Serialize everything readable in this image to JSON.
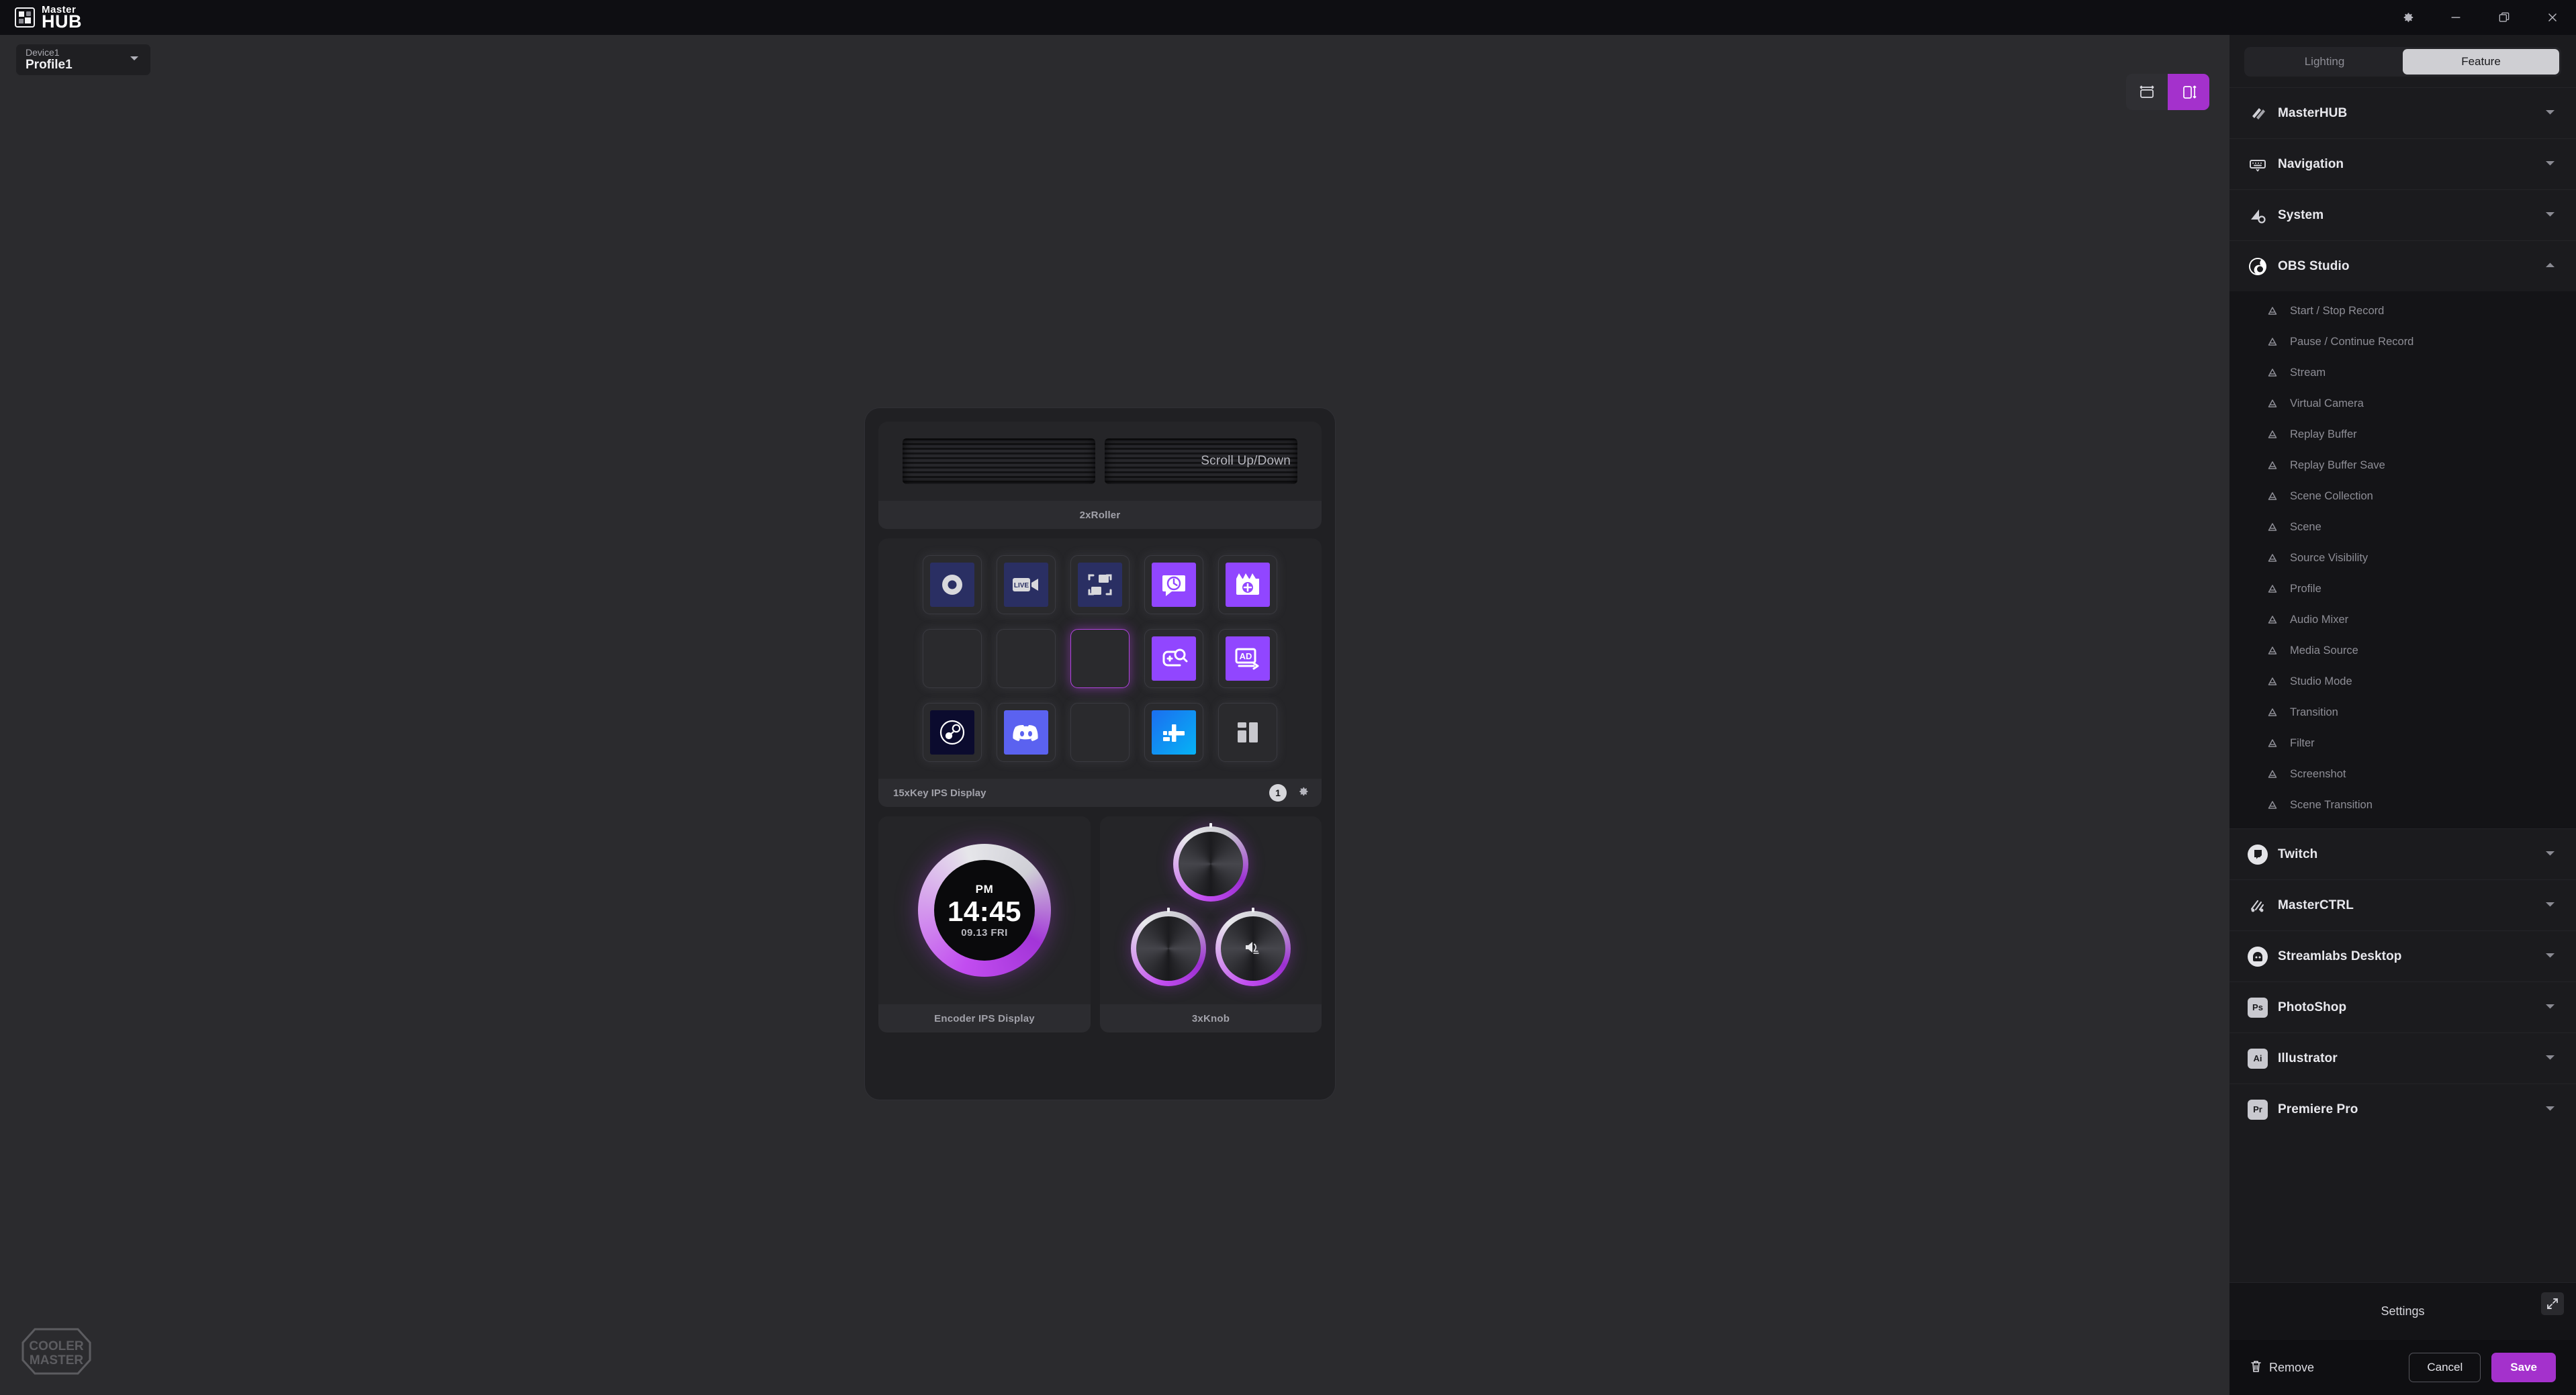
{
  "app": {
    "brand_line1": "Master",
    "brand_line2": "HUB",
    "accent": "#a431cc",
    "selection_accent": "#b044dd"
  },
  "titlebar": {
    "settings_icon": "gear-icon",
    "minimize_icon": "minimize-icon",
    "maximize_icon": "maximize-icon",
    "close_icon": "close-icon"
  },
  "profile": {
    "device_label": "Device1",
    "profile_label": "Profile1",
    "caret_icon": "chevron-down-icon"
  },
  "layout_toggle": {
    "horizontal_label": "horizontal-layout-icon",
    "vertical_label": "vertical-layout-icon",
    "active": "vertical"
  },
  "device": {
    "roller": {
      "panel_label": "2xRoller",
      "scroll_text": "Scroll Up/Down"
    },
    "keys": {
      "panel_label": "15xKey IPS Display",
      "page_number": "1",
      "gear_icon": "gear-icon",
      "rows": [
        [
          {
            "icon": "record-dot-icon",
            "bg": "#2a2f63",
            "state": "filled"
          },
          {
            "icon": "live-camera-icon",
            "bg": "#2a2f63",
            "state": "filled"
          },
          {
            "icon": "screenshot-crop-icon",
            "bg": "#2a2f63",
            "state": "filled"
          },
          {
            "icon": "chat-clock-icon",
            "bg": "#9146ff",
            "state": "filled"
          },
          {
            "icon": "clapper-add-icon",
            "bg": "#9146ff",
            "state": "filled"
          }
        ],
        [
          {
            "icon": "",
            "bg": "",
            "state": "empty"
          },
          {
            "icon": "",
            "bg": "",
            "state": "empty"
          },
          {
            "icon": "",
            "bg": "",
            "state": "selected"
          },
          {
            "icon": "game-search-icon",
            "bg": "#9146ff",
            "state": "filled"
          },
          {
            "icon": "ad-run-icon",
            "bg": "#9146ff",
            "state": "filled"
          }
        ],
        [
          {
            "icon": "steam-icon",
            "bg": "#0b0b2e",
            "state": "filled"
          },
          {
            "icon": "discord-icon",
            "bg": "#5b62f0",
            "state": "filled"
          },
          {
            "icon": "",
            "bg": "",
            "state": "empty"
          },
          {
            "icon": "plus-blue-icon",
            "bg": "#0b96f0",
            "state": "filled"
          },
          {
            "icon": "layout-panels-icon",
            "bg": "",
            "state": "filled"
          }
        ]
      ]
    },
    "encoder": {
      "panel_label": "Encoder IPS Display",
      "clock_ampm": "PM",
      "clock_time": "14:45",
      "clock_date": "09.13 FRI"
    },
    "knobs": {
      "panel_label": "3xKnob",
      "items": [
        {
          "icon": "",
          "position": "top"
        },
        {
          "icon": "",
          "position": "bottom-left"
        },
        {
          "icon": "volume-icon",
          "position": "bottom-right"
        }
      ]
    }
  },
  "sidebar": {
    "tabs": [
      {
        "label": "Lighting",
        "active": false
      },
      {
        "label": "Feature",
        "active": true
      }
    ],
    "categories": [
      {
        "label": "MasterHUB",
        "icon": "masterhub-icon",
        "expanded": false
      },
      {
        "label": "Navigation",
        "icon": "keyboard-icon",
        "expanded": false
      },
      {
        "label": "System",
        "icon": "system-icon",
        "expanded": false
      },
      {
        "label": "OBS Studio",
        "icon": "obs-icon",
        "expanded": true
      },
      {
        "label": "Twitch",
        "icon": "twitch-icon",
        "expanded": false
      },
      {
        "label": "MasterCTRL",
        "icon": "masterctrl-icon",
        "expanded": false
      },
      {
        "label": "Streamlabs Desktop",
        "icon": "streamlabs-icon",
        "expanded": false
      },
      {
        "label": "PhotoShop",
        "icon": "ps-badge",
        "expanded": false
      },
      {
        "label": "Illustrator",
        "icon": "ai-badge",
        "expanded": false
      },
      {
        "label": "Premiere Pro",
        "icon": "pr-badge",
        "expanded": false
      }
    ],
    "obs_items": [
      "Start / Stop Record",
      "Pause / Continue Record",
      "Stream",
      "Virtual Camera",
      "Replay Buffer",
      "Replay Buffer Save",
      "Scene Collection",
      "Scene",
      "Source Visibility",
      "Profile",
      "Audio Mixer",
      "Media Source",
      "Studio Mode",
      "Transition",
      "Filter",
      "Screenshot",
      "Scene Transition"
    ],
    "settings_title": "Settings",
    "expand_icon": "expand-icon",
    "remove_label": "Remove",
    "remove_icon": "trash-icon",
    "cancel_label": "Cancel",
    "save_label": "Save"
  }
}
